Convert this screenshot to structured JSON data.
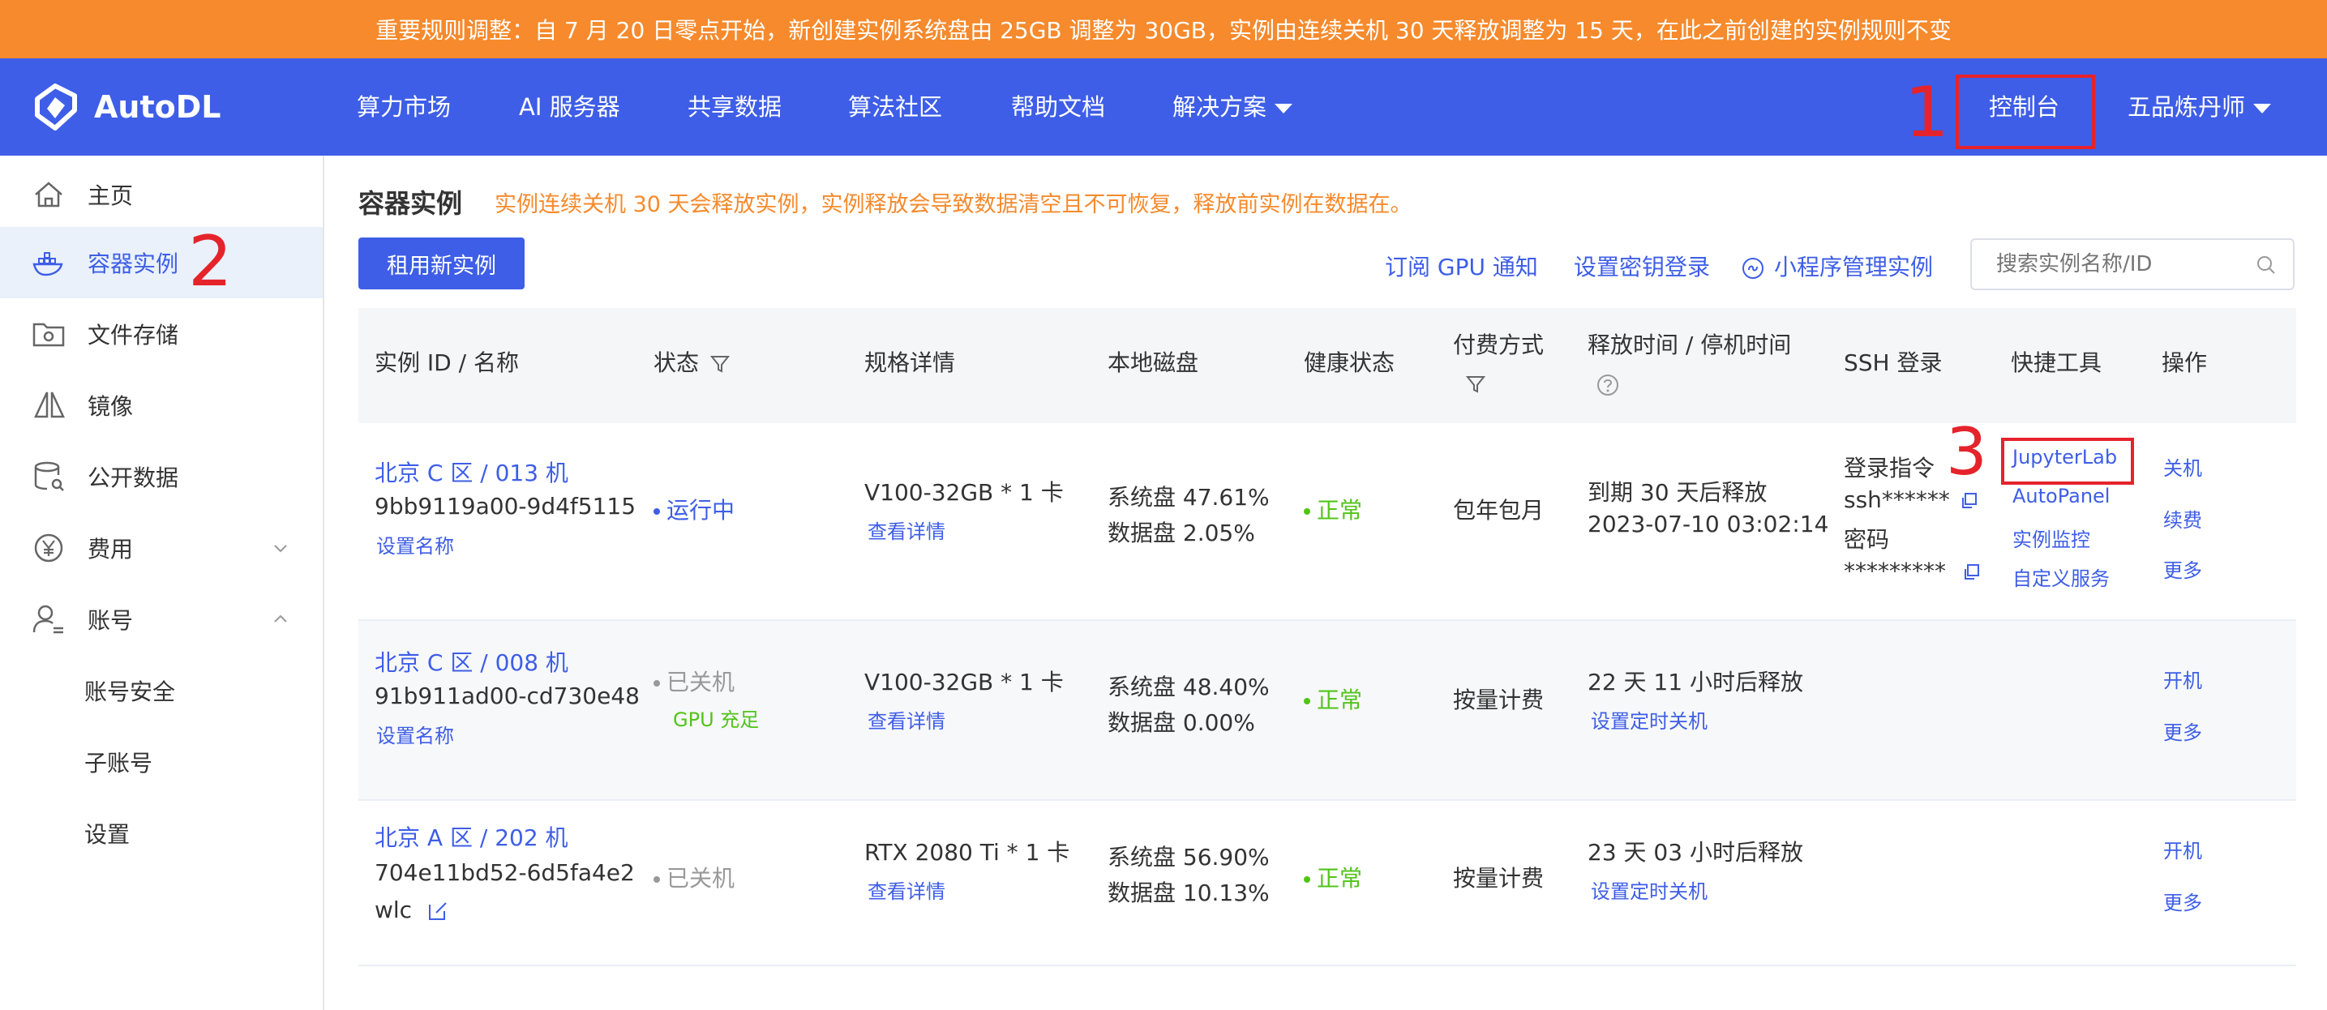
{
  "banner": {
    "text": "重要规则调整：自 7 月 20 日零点开始，新创建实例系统盘由 25GB 调整为 30GB，实例由连续关机 30 天释放调整为 15 天，在此之前创建的实例规则不变"
  },
  "nav": {
    "logo": "AutoDL",
    "items": [
      "算力市场",
      "AI 服务器",
      "共享数据",
      "算法社区",
      "帮助文档",
      "解决方案"
    ],
    "console": "控制台",
    "user": "五品炼丹师"
  },
  "annotations": {
    "n1": "1",
    "n2": "2",
    "n3": "3"
  },
  "sidebar": {
    "items": [
      "主页",
      "容器实例",
      "文件存储",
      "镜像",
      "公开数据",
      "费用",
      "账号"
    ],
    "sub_items": [
      "账号安全",
      "子账号",
      "设置"
    ]
  },
  "main": {
    "title": "容器实例",
    "warning": "实例连续关机 30 天会释放实例，实例释放会导致数据清空且不可恢复，释放前实例在数据在。",
    "rent_button": "租用新实例",
    "links": [
      "订阅 GPU 通知",
      "设置密钥登录",
      "小程序管理实例"
    ],
    "search_placeholder": "搜索实例名称/ID"
  },
  "table": {
    "headers": [
      "实例 ID / 名称",
      "状态",
      "规格详情",
      "本地磁盘",
      "健康状态",
      "付费方式",
      "释放时间 / 停机时间",
      "SSH 登录",
      "快捷工具",
      "操作"
    ],
    "rows": [
      {
        "name": "北京 C 区 / 013 机",
        "id": "9bb9119a00-9d4f5115",
        "set_name": "设置名称",
        "status": "运行中",
        "status_sub": "",
        "spec": "V100-32GB * 1 卡",
        "spec_link": "查看详情",
        "disk_sys": "系统盘 47.61%",
        "disk_data": "数据盘 2.05%",
        "health": "正常",
        "pay": "包年包月",
        "release": "到期 30 天后释放",
        "release_sub": "2023-07-10 03:02:14",
        "ssh_cmd_label": "登录指令",
        "ssh_cmd": "ssh******",
        "ssh_pwd_label": "密码",
        "ssh_pwd": "*********",
        "tools": [
          "JupyterLab",
          "AutoPanel",
          "实例监控",
          "自定义服务"
        ],
        "ops": [
          "关机",
          "续费",
          "更多"
        ]
      },
      {
        "name": "北京 C 区 / 008 机",
        "id": "91b911ad00-cd730e48",
        "set_name": "设置名称",
        "status": "已关机",
        "status_sub": "GPU 充足",
        "spec": "V100-32GB * 1 卡",
        "spec_link": "查看详情",
        "disk_sys": "系统盘 48.40%",
        "disk_data": "数据盘 0.00%",
        "health": "正常",
        "pay": "按量计费",
        "release": "22 天 11 小时后释放",
        "release_sub": "设置定时关机",
        "ops": [
          "开机",
          "更多"
        ]
      },
      {
        "name": "北京 A 区 / 202 机",
        "id": "704e11bd52-6d5fa4e2",
        "id2": "wlc",
        "status": "已关机",
        "spec": "RTX 2080 Ti * 1 卡",
        "spec_link": "查看详情",
        "disk_sys": "系统盘 56.90%",
        "disk_data": "数据盘 10.13%",
        "health": "正常",
        "pay": "按量计费",
        "release": "23 天 03 小时后释放",
        "release_sub": "设置定时关机",
        "ops": [
          "开机",
          "更多"
        ]
      }
    ]
  },
  "colors": {
    "brand": "#3e5ee7",
    "banner": "#f68a2c",
    "annotation_red": "#e5232b",
    "healthy_green": "#52c41a"
  }
}
